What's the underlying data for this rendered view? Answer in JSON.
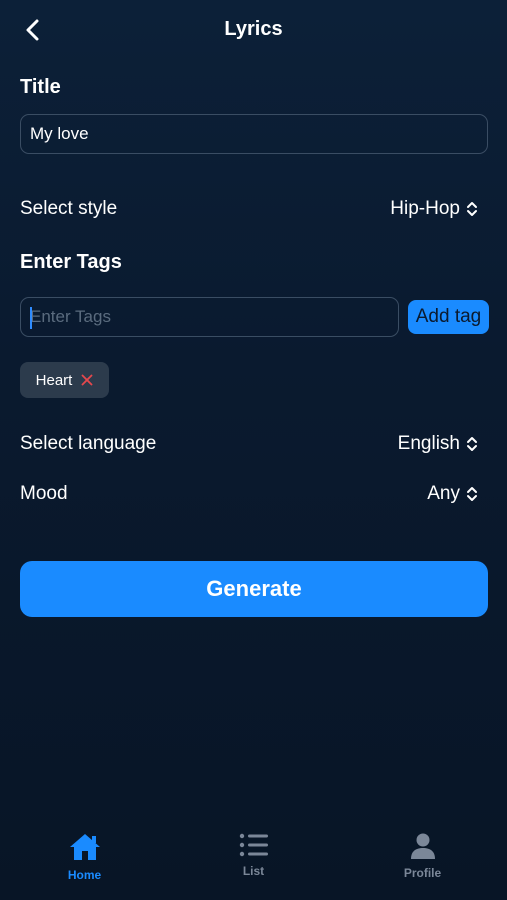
{
  "header": {
    "title": "Lyrics",
    "back_icon": "chevron-left-icon"
  },
  "form": {
    "title_label": "Title",
    "title_value": "My love",
    "style_label": "Select style",
    "style_value": "Hip-Hop",
    "tags_label": "Enter Tags",
    "tags_placeholder": "Enter Tags",
    "add_tag_label": "Add tag",
    "tags": [
      {
        "label": "Heart"
      }
    ],
    "language_label": "Select language",
    "language_value": "English",
    "mood_label": "Mood",
    "mood_value": "Any",
    "generate_label": "Generate"
  },
  "tab_bar": {
    "items": [
      {
        "label": "Home",
        "icon": "home-icon",
        "active": true
      },
      {
        "label": "List",
        "icon": "list-icon",
        "active": false
      },
      {
        "label": "Profile",
        "icon": "person-icon",
        "active": false
      }
    ]
  },
  "colors": {
    "background": "#0a1a2f",
    "accent": "#1a8bff",
    "chip": "#2c3b4c",
    "remove": "#e5484d",
    "inactive_tab": "#7b8798"
  }
}
